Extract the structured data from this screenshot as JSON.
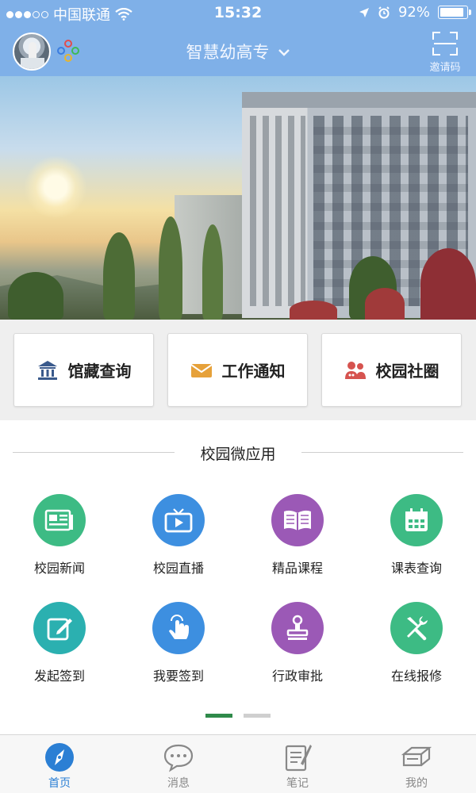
{
  "status_bar": {
    "carrier": "中国联通",
    "time": "15:32",
    "battery": "92%",
    "battery_level": 0.92
  },
  "header": {
    "title": "智慧幼高专",
    "invite_label": "邀请码"
  },
  "quick_entries": [
    {
      "label": "馆藏查询",
      "icon": "library-icon",
      "color": "#3a5a8c"
    },
    {
      "label": "工作通知",
      "icon": "envelope-icon",
      "color": "#e6a13a"
    },
    {
      "label": "校园社圈",
      "icon": "people-icon",
      "color": "#d6534f"
    }
  ],
  "apps_section": {
    "title": "校园微应用",
    "apps": [
      {
        "label": "校园新闻",
        "icon": "newspaper-icon",
        "color": "#3dbb84"
      },
      {
        "label": "校园直播",
        "icon": "tv-play-icon",
        "color": "#3d8fe0"
      },
      {
        "label": "精品课程",
        "icon": "open-book-icon",
        "color": "#9b59b6"
      },
      {
        "label": "课表查询",
        "icon": "calendar-icon",
        "color": "#3dbb84"
      },
      {
        "label": "发起签到",
        "icon": "edit-icon",
        "color": "#2bb0b0"
      },
      {
        "label": "我要签到",
        "icon": "tap-hand-icon",
        "color": "#3d8fe0"
      },
      {
        "label": "行政审批",
        "icon": "stamp-icon",
        "color": "#9b59b6"
      },
      {
        "label": "在线报修",
        "icon": "tools-icon",
        "color": "#3dbb84"
      }
    ],
    "pager": {
      "pages": 2,
      "current": 1
    }
  },
  "tab_bar": [
    {
      "label": "首页",
      "icon": "compass-icon",
      "active": true
    },
    {
      "label": "消息",
      "icon": "chat-bubble-icon",
      "active": false
    },
    {
      "label": "笔记",
      "icon": "note-icon",
      "active": false
    },
    {
      "label": "我的",
      "icon": "layers-icon",
      "active": false
    }
  ],
  "colors": {
    "header_bg": "#7fb0e8",
    "accent_blue": "#2b7fd4",
    "pager_active": "#2f8a4a"
  }
}
